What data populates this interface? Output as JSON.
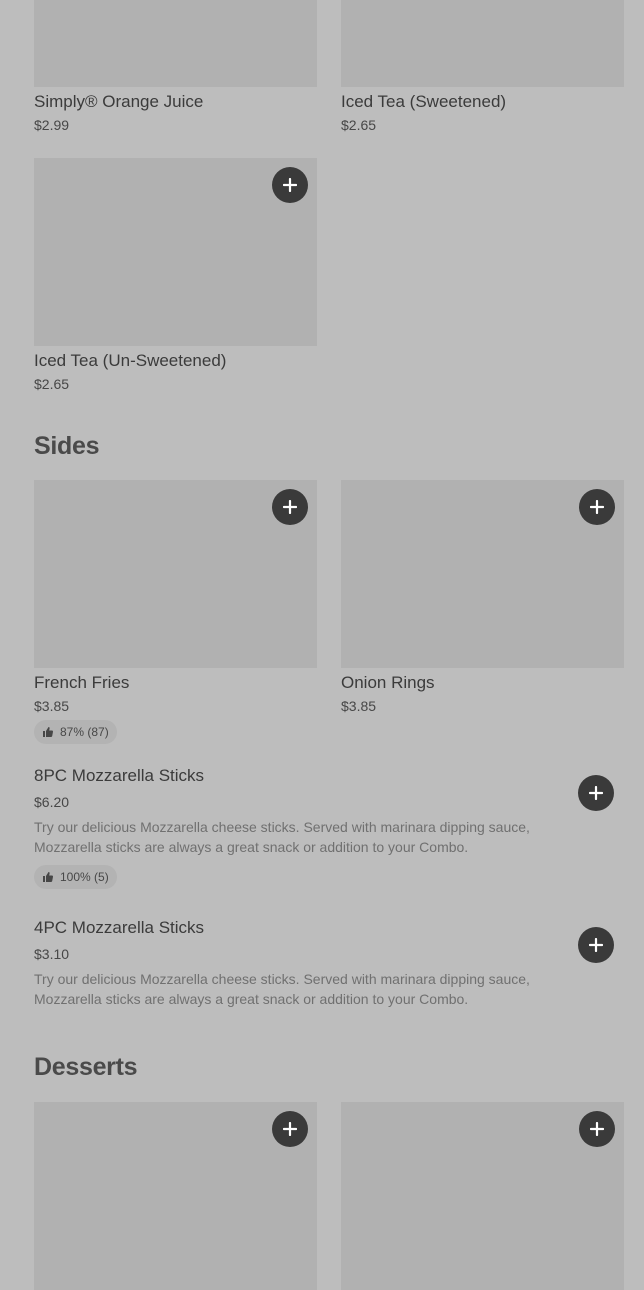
{
  "drinks": [
    {
      "name": "Simply® Orange Juice",
      "price": "$2.99"
    },
    {
      "name": "Iced Tea (Sweetened)",
      "price": "$2.65"
    },
    {
      "name": "Iced Tea (Un-Sweetened)",
      "price": "$2.65"
    }
  ],
  "sides": {
    "title": "Sides",
    "cards": [
      {
        "name": "French Fries",
        "price": "$3.85",
        "rating": "87% (87)"
      },
      {
        "name": "Onion Rings",
        "price": "$3.85"
      }
    ],
    "rows": [
      {
        "name": "8PC Mozzarella Sticks",
        "price": "$6.20",
        "description": "Try our delicious Mozzarella cheese sticks. Served with marinara dipping sauce, Mozzarella sticks are always a great snack or addition to your Combo.",
        "rating": "100% (5)"
      },
      {
        "name": "4PC Mozzarella Sticks",
        "price": "$3.10",
        "description": "Try our delicious Mozzarella cheese sticks. Served with marinara dipping sauce, Mozzarella sticks are always a great snack or addition to your Combo."
      }
    ]
  },
  "desserts": {
    "title": "Desserts"
  },
  "icons": {
    "add": "plus-icon",
    "rating": "thumbs-up-icon"
  },
  "colors": {
    "background": "#bdbdbd",
    "image_placeholder": "#b1b1b1",
    "button": "#3a3a3a"
  }
}
